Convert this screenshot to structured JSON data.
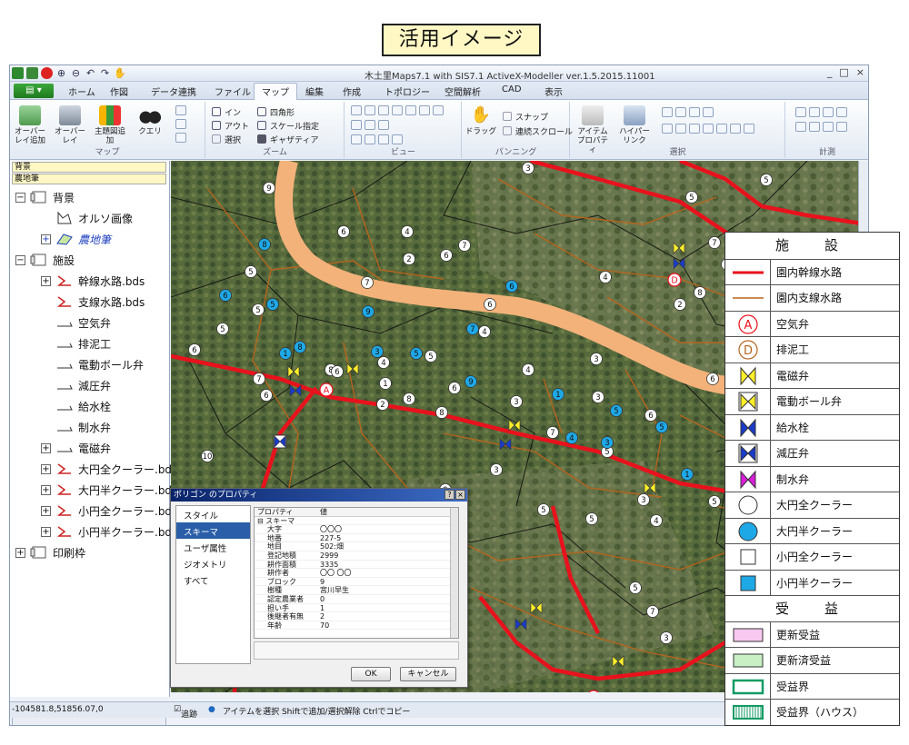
{
  "caption": "活用イメージ",
  "app": {
    "title": "木土里Maps7.1  with SIS7.1 ActiveX-Modeller   ver.1.5.2015.11001",
    "file_button": "▾",
    "tabs": [
      "ホーム",
      "作図",
      "データ連携",
      "ファイル",
      "マップ",
      "編集",
      "作成",
      "トポロジー",
      "空間解析",
      "CAD",
      "表示"
    ],
    "active_tab": "マップ",
    "window_controls": [
      "_",
      "□",
      "×"
    ]
  },
  "ribbon": {
    "map_group": {
      "label": "マップ",
      "buttons": [
        "オーバーレイ追加",
        "オーバーレイ",
        "主題図追加",
        "クエリ"
      ]
    },
    "zoom_group": {
      "label": "ズーム",
      "buttons": [
        "イン",
        "アウト",
        "選択",
        "四角形",
        "スケール指定",
        "ギャザティア"
      ]
    },
    "view_group": {
      "label": "ビュー"
    },
    "panning_group": {
      "label": "パンニング",
      "buttons": [
        "ドラッグ",
        "スナップ",
        "連続スクロール"
      ]
    },
    "select_group": {
      "label": "選択",
      "buttons": [
        "アイテムプロパティ",
        "ハイパーリンク"
      ]
    },
    "measure_group": {
      "label": "計測"
    }
  },
  "left_panel": {
    "header1": "背景",
    "header2": "農地筆",
    "tree": [
      {
        "label": "背景",
        "level": 0,
        "expand": "−",
        "icon": "folder-icon"
      },
      {
        "label": "オルソ画像",
        "level": 1,
        "expand": "",
        "icon": "image-layer-icon"
      },
      {
        "label": "農地筆",
        "level": 1,
        "expand": "+",
        "icon": "polygon-layer-icon",
        "highlight": true
      },
      {
        "label": "施設",
        "level": 0,
        "expand": "−",
        "icon": "folder-icon"
      },
      {
        "label": "幹線水路.bds",
        "level": 1,
        "expand": "+",
        "icon": "line-layer-icon"
      },
      {
        "label": "支線水路.bds",
        "level": 1,
        "expand": "",
        "icon": "line-layer-icon"
      },
      {
        "label": "空気弁",
        "level": 1,
        "expand": "",
        "icon": "empty-layer-icon"
      },
      {
        "label": "排泥工",
        "level": 1,
        "expand": "",
        "icon": "empty-layer-icon"
      },
      {
        "label": "電動ボール弁",
        "level": 1,
        "expand": "",
        "icon": "empty-layer-icon"
      },
      {
        "label": "減圧弁",
        "level": 1,
        "expand": "",
        "icon": "empty-layer-icon"
      },
      {
        "label": "給水栓",
        "level": 1,
        "expand": "",
        "icon": "empty-layer-icon"
      },
      {
        "label": "制水弁",
        "level": 1,
        "expand": "",
        "icon": "empty-layer-icon"
      },
      {
        "label": "電磁弁",
        "level": 1,
        "expand": "+",
        "icon": "empty-layer-icon"
      },
      {
        "label": "大円全クーラー.bds",
        "level": 1,
        "expand": "+",
        "icon": "line-layer-icon"
      },
      {
        "label": "大円半クーラー.bds",
        "level": 1,
        "expand": "+",
        "icon": "line-layer-icon"
      },
      {
        "label": "小円全クーラー.bds",
        "level": 1,
        "expand": "+",
        "icon": "line-layer-icon"
      },
      {
        "label": "小円半クーラー.bds",
        "level": 1,
        "expand": "+",
        "icon": "line-layer-icon"
      },
      {
        "label": "印刷枠",
        "level": 0,
        "expand": "+",
        "icon": "folder-icon"
      }
    ]
  },
  "dialog": {
    "title": "ポリゴン のプロパティ",
    "menu": [
      "スタイル",
      "スキーマ",
      "ユーザ属性",
      "ジオメトリ",
      "すべて"
    ],
    "selected_menu": "スキーマ",
    "columns": [
      "プロパティ",
      "値"
    ],
    "group": "スキーマ",
    "rows": [
      [
        "大字",
        "〇〇〇"
      ],
      [
        "地番",
        "227-5"
      ],
      [
        "地目",
        "502:畑"
      ],
      [
        "登記地積",
        "2999"
      ],
      [
        "耕作面積",
        "3335"
      ],
      [
        "耕作者",
        "〇〇 〇〇"
      ],
      [
        "ブロック",
        "9"
      ],
      [
        "樹種",
        "宮川早生"
      ],
      [
        "認定農業者",
        "0"
      ],
      [
        "担い手",
        "1"
      ],
      [
        "後継者有無",
        "2"
      ],
      [
        "年齢",
        "70"
      ]
    ],
    "ok": "OK",
    "cancel": "キャンセル"
  },
  "status": {
    "coords": "-104581.8,51856.07,0",
    "snap_label": "追跡",
    "hint": "アイテムを選択  Shiftで追加/選択解除  Ctrlでコピー"
  },
  "legend": {
    "facilities_title": "施　設",
    "benefit_title": "受　益",
    "facilities": [
      {
        "label": "園内幹線水路",
        "symbol": "red-line"
      },
      {
        "label": "園内支線水路",
        "symbol": "brown-line"
      },
      {
        "label": "空気弁",
        "symbol": "circle-a"
      },
      {
        "label": "排泥工",
        "symbol": "circle-d"
      },
      {
        "label": "電磁弁",
        "symbol": "yellow-bowtie"
      },
      {
        "label": "電動ボール弁",
        "symbol": "yellow-box-bowtie"
      },
      {
        "label": "給水栓",
        "symbol": "blue-bowtie"
      },
      {
        "label": "減圧弁",
        "symbol": "blue-box-bowtie"
      },
      {
        "label": "制水弁",
        "symbol": "magenta-bowtie"
      },
      {
        "label": "大円全クーラー",
        "symbol": "big-circle-empty"
      },
      {
        "label": "大円半クーラー",
        "symbol": "big-circle-blue"
      },
      {
        "label": "小円全クーラー",
        "symbol": "square-empty"
      },
      {
        "label": "小円半クーラー",
        "symbol": "square-blue"
      }
    ],
    "benefits": [
      {
        "label": "更新受益",
        "symbol": "pink-rect"
      },
      {
        "label": "更新済受益",
        "symbol": "green-rect"
      },
      {
        "label": "受益界",
        "symbol": "teal-border"
      },
      {
        "label": "受益界（ハウス）",
        "symbol": "teal-striped"
      }
    ]
  },
  "colors": {
    "main_canal": "#e8121d",
    "branch_canal": "#b5651d",
    "road": "#f3b27a",
    "valve_yellow": "#ffef2a",
    "valve_blue": "#1a3cc8",
    "cooler_blue": "#1fa8e6",
    "caption_bg": "#fff8c4"
  }
}
